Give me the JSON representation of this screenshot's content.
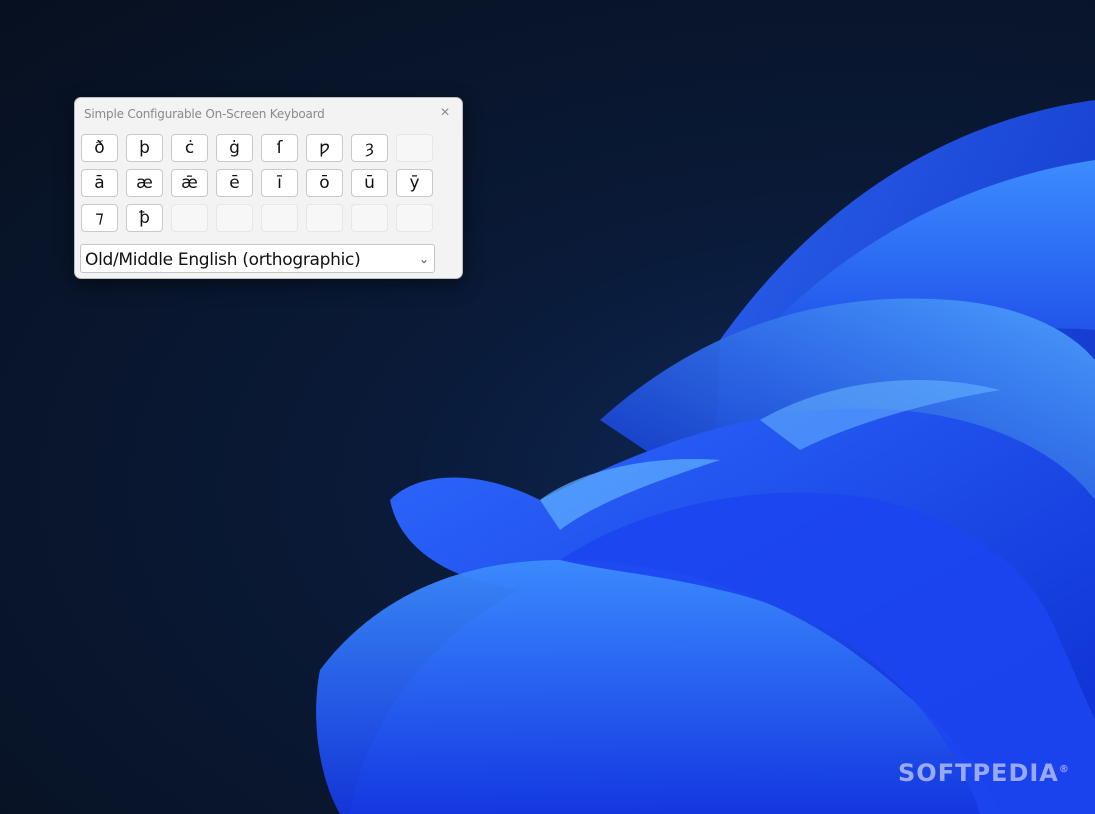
{
  "window": {
    "title": "Simple Configurable On-Screen Keyboard",
    "close_icon": "×"
  },
  "keys": {
    "row1": [
      "ð",
      "þ",
      "ċ",
      "ġ",
      "ſ",
      "ƿ",
      "ȝ",
      ""
    ],
    "row2": [
      "ā",
      "æ",
      "ǣ",
      "ē",
      "ī",
      "ō",
      "ū",
      "ȳ"
    ],
    "row3": [
      "⁊",
      "ꝥ",
      "",
      "",
      "",
      "",
      "",
      ""
    ]
  },
  "layout_select": {
    "value": "Old/Middle English (orthographic)"
  },
  "watermark": "SOFTPEDIA",
  "colors": {
    "bloom": "#1f4dff",
    "background": "#07101f",
    "window": "#f3f3f3"
  }
}
